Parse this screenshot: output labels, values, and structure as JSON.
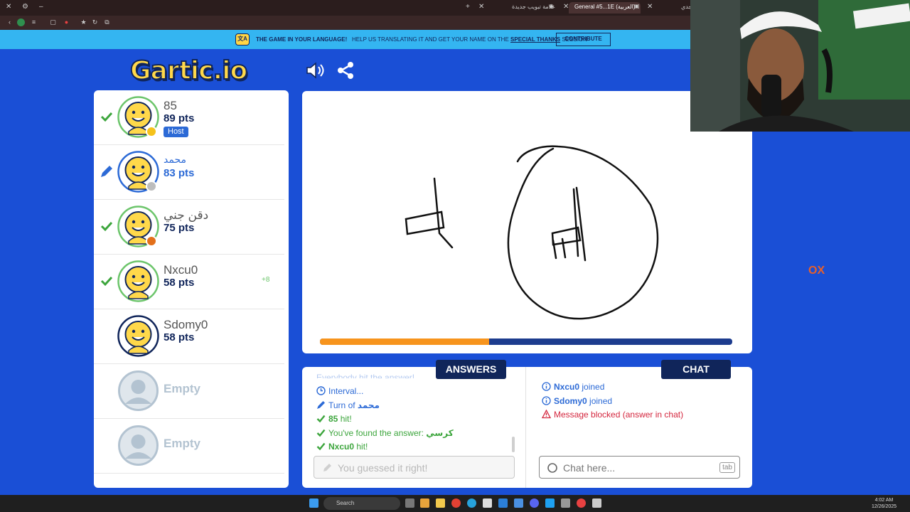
{
  "browser": {
    "tabs": [
      {
        "label": "علامة تبويب جديدة",
        "active": false
      },
      {
        "label": "General #5...1E (العربية)",
        "active": true
      }
    ],
    "partial_tab": "جدي"
  },
  "banner": {
    "icon_text": "文A",
    "headline": "THE GAME IN YOUR LANGUAGE!",
    "text_before": "HELP US TRANSLATING IT AND GET YOUR NAME ON THE",
    "text_link": "SPECIAL THANKS",
    "text_after": "SESSION",
    "contribute_label": "CONTRIBUTE"
  },
  "logo": "Gartic.io",
  "players": [
    {
      "name": "85",
      "points": "89 pts",
      "badge": "Host",
      "mark": "check",
      "name_style": "normal",
      "status_color": "#f5c21b"
    },
    {
      "name": "محمد",
      "points": "83 pts",
      "badge": "",
      "mark": "pencil",
      "name_style": "blue",
      "status_color": "#bdbdbd"
    },
    {
      "name": "دقن جني",
      "points": "75 pts",
      "badge": "",
      "mark": "check",
      "name_style": "normal",
      "status_color": "#e3701b"
    },
    {
      "name": "Nxcu0",
      "points": "58 pts",
      "badge": "",
      "mark": "check",
      "name_style": "normal",
      "bonus": "+8"
    },
    {
      "name": "Sdomy0",
      "points": "58 pts",
      "badge": "",
      "mark": "none",
      "name_style": "normal"
    }
  ],
  "empty_slots": [
    {
      "label": "Empty"
    },
    {
      "label": "Empty"
    }
  ],
  "timer": {
    "progress": 0.41
  },
  "answers": {
    "tab_label": "ANSWERS",
    "cut_line": "Everybody hit the answer!",
    "messages": [
      {
        "icon": "clock",
        "color": "blue",
        "bold": "",
        "text": "Interval..."
      },
      {
        "icon": "pencil",
        "color": "blue",
        "bold": "",
        "text": "Turn of ",
        "bold_after": "محمد"
      },
      {
        "icon": "check",
        "color": "green",
        "bold": "85",
        "text": " hit!"
      },
      {
        "icon": "check",
        "color": "green",
        "bold": "",
        "text": "You've found the answer: ",
        "bold_after": "كرسي"
      },
      {
        "icon": "check",
        "color": "green",
        "bold": "Nxcu0",
        "text": " hit!"
      }
    ],
    "input_placeholder": "You guessed it right!"
  },
  "chat": {
    "tab_label": "CHAT",
    "messages": [
      {
        "icon": "info",
        "color": "blue",
        "bold": "Nxcu0",
        "text": " joined"
      },
      {
        "icon": "info",
        "color": "blue",
        "bold": "Sdomy0",
        "text": " joined"
      },
      {
        "icon": "warning",
        "color": "red",
        "bold": "",
        "text": "Message blocked (answer in chat)"
      }
    ],
    "input_placeholder": "Chat here...",
    "key_hint": "tab"
  },
  "side_text": "OX",
  "taskbar": {
    "search_placeholder": "Search",
    "time": "4:02 AM",
    "date": "12/26/2025"
  }
}
